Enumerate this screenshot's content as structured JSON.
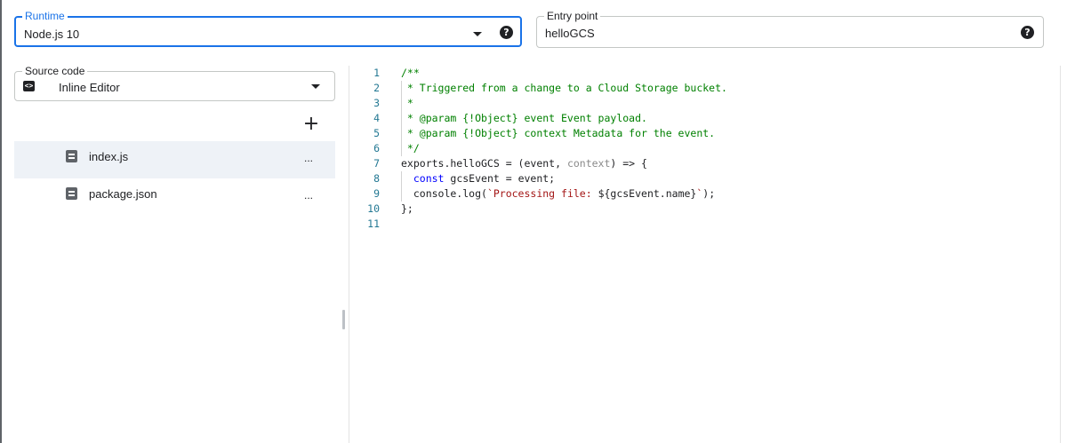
{
  "runtime": {
    "label": "Runtime",
    "value": "Node.js 10",
    "help_icon": "help-circle-icon"
  },
  "entry_point": {
    "label": "Entry point",
    "value": "helloGCS",
    "help_icon": "help-circle-icon"
  },
  "source_code": {
    "label": "Source code",
    "value": "Inline Editor",
    "icon": "code-icon"
  },
  "add_file_label": "+",
  "files": [
    {
      "name": "index.js",
      "more": "...",
      "selected": true
    },
    {
      "name": "package.json",
      "more": "...",
      "selected": false
    }
  ],
  "editor": {
    "lines": [
      {
        "num": "1",
        "tokens": [
          {
            "t": "/**",
            "c": "comment"
          }
        ]
      },
      {
        "num": "2",
        "tokens": [
          {
            "t": " * Triggered from a change to a Cloud Storage bucket.",
            "c": "comment"
          }
        ]
      },
      {
        "num": "3",
        "tokens": [
          {
            "t": " *",
            "c": "comment"
          }
        ]
      },
      {
        "num": "4",
        "tokens": [
          {
            "t": " * @param {!Object} event Event payload.",
            "c": "comment"
          }
        ]
      },
      {
        "num": "5",
        "tokens": [
          {
            "t": " * @param {!Object} context Metadata for the event.",
            "c": "comment"
          }
        ]
      },
      {
        "num": "6",
        "tokens": [
          {
            "t": " */",
            "c": "comment"
          }
        ]
      },
      {
        "num": "7",
        "tokens": [
          {
            "t": "exports.helloGCS = (event, ",
            "c": "plain"
          },
          {
            "t": "context",
            "c": "dim"
          },
          {
            "t": ") => {",
            "c": "plain"
          }
        ]
      },
      {
        "num": "8",
        "tokens": [
          {
            "t": "  ",
            "c": "plain"
          },
          {
            "t": "const",
            "c": "kw"
          },
          {
            "t": " gcsEvent = event;",
            "c": "plain"
          }
        ]
      },
      {
        "num": "9",
        "tokens": [
          {
            "t": "  console.log(",
            "c": "plain"
          },
          {
            "t": "`Processing file: ",
            "c": "str"
          },
          {
            "t": "${gcsEvent.name}",
            "c": "plain"
          },
          {
            "t": "`",
            "c": "str"
          },
          {
            "t": ");",
            "c": "plain"
          }
        ]
      },
      {
        "num": "10",
        "tokens": [
          {
            "t": "};",
            "c": "plain"
          }
        ]
      },
      {
        "num": "11",
        "tokens": []
      }
    ]
  }
}
